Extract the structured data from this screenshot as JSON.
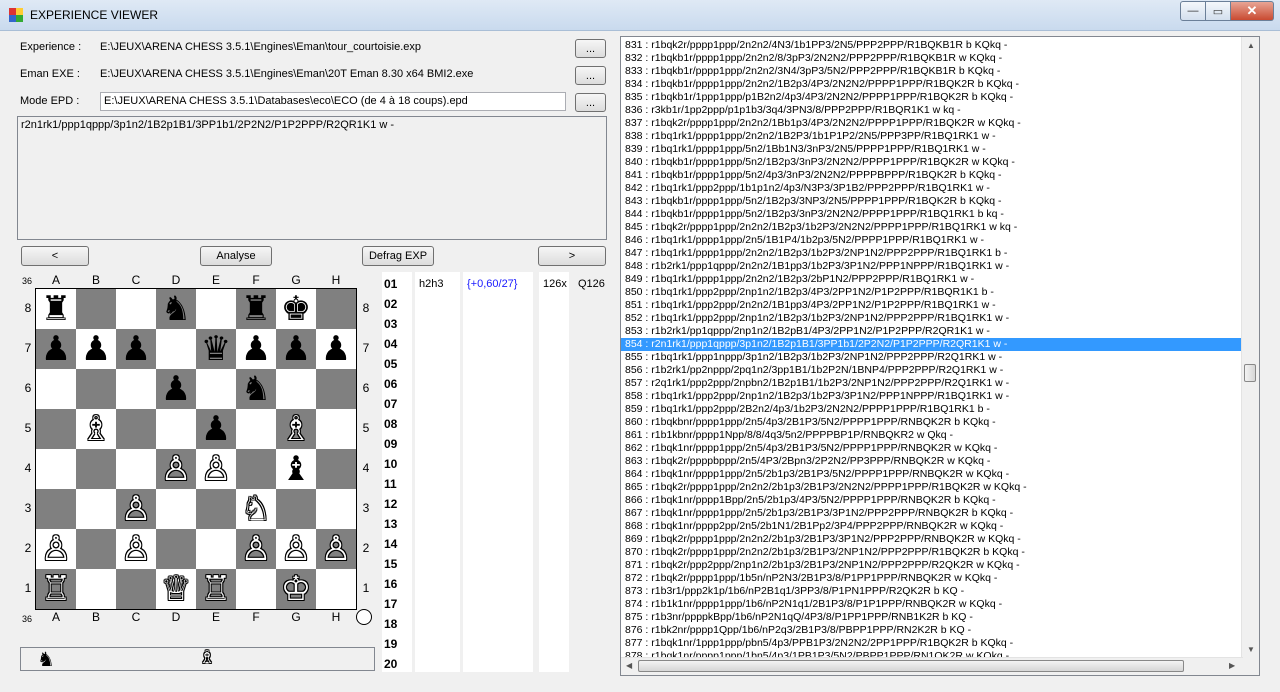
{
  "window": {
    "title": "EXPERIENCE VIEWER",
    "min": "—",
    "max": "▭",
    "close": "✕"
  },
  "fields": {
    "experience_label": "Experience :",
    "experience_path": "E:\\JEUX\\ARENA CHESS 3.5.1\\Engines\\Eman\\tour_courtoisie.exp",
    "eman_label": "Eman EXE :",
    "eman_path": "E:\\JEUX\\ARENA CHESS 3.5.1\\Engines\\Eman\\20T Eman 8.30 x64 BMI2.exe",
    "epd_label": "Mode EPD :",
    "epd_path": "E:\\JEUX\\ARENA CHESS 3.5.1\\Databases\\eco\\ECO (de 4 à 18 coups).epd",
    "browse": "...",
    "fen": "r2n1rk1/ppp1qppp/3p1n2/1B2p1B1/3PP1b1/2P2N2/P1P2PPP/R2QR1K1 w -"
  },
  "buttons": {
    "prev": "<",
    "analyse": "Analyse",
    "defrag": "Defrag EXP",
    "next": ">"
  },
  "board": {
    "files": [
      "A",
      "B",
      "C",
      "D",
      "E",
      "F",
      "G",
      "H"
    ],
    "ranks": [
      "8",
      "7",
      "6",
      "5",
      "4",
      "3",
      "2",
      "1"
    ],
    "corner": "36",
    "rows": [
      [
        "♜",
        "",
        "",
        "♞",
        "",
        "♜",
        "♚",
        ""
      ],
      [
        "♟",
        "♟",
        "♟",
        "",
        "♛",
        "♟",
        "♟",
        "♟"
      ],
      [
        "",
        "",
        "",
        "♟",
        "",
        "♞",
        "",
        ""
      ],
      [
        "",
        "♗",
        "",
        "",
        "♟",
        "",
        "♗",
        ""
      ],
      [
        "",
        "",
        "",
        "♙",
        "♙",
        "",
        "♝",
        ""
      ],
      [
        "",
        "",
        "♙",
        "",
        "",
        "♘",
        "",
        ""
      ],
      [
        "♙",
        "",
        "♙",
        "",
        "",
        "♙",
        "♙",
        "♙"
      ],
      [
        "♖",
        "",
        "",
        "♕",
        "♖",
        "",
        "♔",
        ""
      ]
    ]
  },
  "moves": {
    "numbers": [
      "01",
      "02",
      "03",
      "04",
      "05",
      "06",
      "07",
      "08",
      "09",
      "10",
      "11",
      "12",
      "13",
      "14",
      "15",
      "16",
      "17",
      "18",
      "19",
      "20"
    ],
    "first_move": "h2h3",
    "first_score": "{+0,60/27}",
    "first_count": "126x",
    "first_quality": "Q126"
  },
  "status_icons": {
    "black": "♞",
    "white": "♗"
  },
  "list": {
    "selected_index": 23,
    "items": [
      "831 : r1bqk2r/pppp1ppp/2n2n2/4N3/1b1PP3/2N5/PPP2PPP/R1BQKB1R b KQkq -",
      "832 : r1bqkb1r/pppp1ppp/2n2n2/8/3pP3/2N2N2/PPP2PPP/R1BQKB1R w KQkq -",
      "833 : r1bqkb1r/pppp1ppp/2n2n2/3N4/3pP3/5N2/PPP2PPP/R1BQKB1R b KQkq -",
      "834 : r1bqkb1r/pppp1ppp/2n2n2/1B2p3/4P3/2N2N2/PPPP1PPP/R1BQK2R b KQkq -",
      "835 : r1bqkb1r/1ppp1ppp/p1B2n2/4p3/4P3/2N2N2/PPPP1PPP/R1BQK2R b KQkq -",
      "836 : r3kb1r/1pp2ppp/p1p1b3/3q4/3PN3/8/PPP2PPP/R1BQR1K1 w kq -",
      "837 : r1bqk2r/pppp1ppp/2n2n2/1Bb1p3/4P3/2N2N2/PPPP1PPP/R1BQK2R w KQkq -",
      "838 : r1bq1rk1/pppp1ppp/2n2n2/1B2P3/1b1P1P2/2N5/PPP3PP/R1BQ1RK1 w -",
      "839 : r1bq1rk1/pppp1ppp/5n2/1Bb1N3/3nP3/2N5/PPPP1PPP/R1BQ1RK1 w -",
      "840 : r1bqkb1r/pppp1ppp/5n2/1B2p3/3nP3/2N2N2/PPPP1PPP/R1BQK2R w KQkq -",
      "841 : r1bqkb1r/pppp1ppp/5n2/4p3/3nP3/2N2N2/PPPPBPPP/R1BQK2R b KQkq -",
      "842 : r1bq1rk1/ppp2ppp/1b1p1n2/4p3/N3P3/3P1B2/PPP2PPP/R1BQ1RK1 w -",
      "843 : r1bqkb1r/pppp1ppp/5n2/1B2p3/3NP3/2N5/PPPP1PPP/R1BQK2R b KQkq -",
      "844 : r1bqkb1r/pppp1ppp/5n2/1B2p3/3nP3/2N2N2/PPPP1PPP/R1BQ1RK1 b kq -",
      "845 : r1bqk2r/pppp1ppp/2n2n2/1B2p3/1b2P3/2N2N2/PPPP1PPP/R1BQ1RK1 w kq -",
      "846 : r1bq1rk1/pppp1ppp/2n5/1B1P4/1b2p3/5N2/PPPP1PPP/R1BQ1RK1 w -",
      "847 : r1bq1rk1/pppp1ppp/2n2n2/1B2p3/1b2P3/2NP1N2/PPP2PPP/R1BQ1RK1 b -",
      "848 : r1b2rk1/ppp1qppp/2n2n2/1B1pp3/1b2P3/3P1N2/PPP1NPPP/R1BQ1RK1 w -",
      "849 : r1bq1rk1/pppp1ppp/2n2n2/1B2p3/2bP1N2/PPP2PPP/R1BQ1RK1 w -",
      "850 : r1bq1rk1/ppp2ppp/2np1n2/1B2p3/4P3/2PP1N2/P1P2PPP/R1BQR1K1 b -",
      "851 : r1bq1rk1/ppp2ppp/2n2n2/1B1pp3/4P3/2PP1N2/P1P2PPP/R1BQ1RK1 w -",
      "852 : r1bq1rk1/ppp2ppp/2np1n2/1B2p3/1b2P3/2NP1N2/PPP2PPP/R1BQ1RK1 w -",
      "853 : r1b2rk1/pp1qppp/2np1n2/1B2pB1/4P3/2PP1N2/P1P2PPP/R2QR1K1 w -",
      "854 : r2n1rk1/ppp1qppp/3p1n2/1B2p1B1/3PP1b1/2P2N2/P1P2PPP/R2QR1K1 w -",
      "855 : r1bq1rk1/ppp1nppp/3p1n2/1B2p3/1b2P3/2NP1N2/PPP2PPP/R2Q1RK1 w -",
      "856 : r1b2rk1/pp2nppp/2pq1n2/3pp1B1/1b2P2N/1BNP4/PPP2PPP/R2Q1RK1 w -",
      "857 : r2q1rk1/ppp2ppp/2npbn2/1B2p1B1/1b2P3/2NP1N2/PPP2PPP/R2Q1RK1 w -",
      "858 : r1bq1rk1/ppp2ppp/2np1n2/1B2p3/1b2P3/3P1N2/PPP1NPPP/R1BQ1RK1 w -",
      "859 : r1bq1rk1/ppp2ppp/2B2n2/4p3/1b2P3/2N2N2/PPPP1PPP/R1BQ1RK1 b -",
      "860 : r1bqkbnr/pppp1ppp/2n5/4p3/2B1P3/5N2/PPPP1PPP/RNBQK2R b KQkq -",
      "861 : r1b1kbnr/pppp1Npp/8/8/4q3/5n2/PPPPBP1P/RNBQKR2 w Qkq -",
      "862 : r1bqk1nr/pppp1ppp/2n5/4p3/2B1P3/5N2/PPPP1PPP/RNBQK2R w KQkq -",
      "863 : r1bqk2r/ppppbppp/2n5/4P3/2Bpn3/2P2N2/PP3PPP/RNBQK2R w KQkq -",
      "864 : r1bqk1nr/pppp1ppp/2n5/2b1p3/2B1P3/5N2/PPPP1PPP/RNBQK2R w KQkq -",
      "865 : r1bqk2r/pppp1ppp/2n2n2/2b1p3/2B1P3/2N2N2/PPPP1PPP/R1BQK2R w KQkq -",
      "866 : r1bqk1nr/pppp1Bpp/2n5/2b1p3/4P3/5N2/PPPP1PPP/RNBQK2R b KQkq -",
      "867 : r1bqk1nr/pppp1ppp/2n5/2b1p3/2B1P3/3P1N2/PPP2PPP/RNBQK2R b KQkq -",
      "868 : r1bqk1nr/pppp2pp/2n5/2b1N1/2B1Pp2/3P4/PPP2PPP/RNBQK2R w KQkq -",
      "869 : r1bqk2r/pppp1ppp/2n2n2/2b1p3/2B1P3/3P1N2/PPP2PPP/RNBQK2R w KQkq -",
      "870 : r1bqk2r/pppp1ppp/2n2n2/2b1p3/2B1P3/2NP1N2/PPP2PPP/R1BQK2R b KQkq -",
      "871 : r1bqk2r/ppp2ppp/2np1n2/2b1p3/2B1P3/2NP1N2/PPP2PPP/R2QK2R w KQkq -",
      "872 : r1bqk2r/pppp1ppp/1b5n/nP2N3/2B1P3/8/P1PP1PPP/RNBQK2R w KQkq -",
      "873 : r1b3r1/ppp2k1p/1b6/nP2B1q1/3PP3/8/P1PN1PPP/R2QK2R b KQ -",
      "874 : r1b1k1nr/pppp1ppp/1b6/nP2N1q1/2B1P3/8/P1P1PPP/RNBQK2R w KQkq -",
      "875 : r1b3nr/ppppkBpp/1b6/nP2N1qQ/4P3/8/P1PP1PPP/RNB1K2R b KQ -",
      "876 : r1bk2nr/pppp1Qpp/1b6/nP2q3/2B1P3/8/PBPP1PPP/RN2K2R b KQ -",
      "877 : r1bqk1nr/1ppp1ppp/pbn5/4p3/PPB1P3/2N2N2/2PP1PPP/R1BQK2R b KQkq -",
      "878 : r1bqk1nr/pppp1ppp/1bn5/4p3/1PB1P3/5N2/PBPP1PPP/RN1QK2R w KQkq -"
    ]
  }
}
